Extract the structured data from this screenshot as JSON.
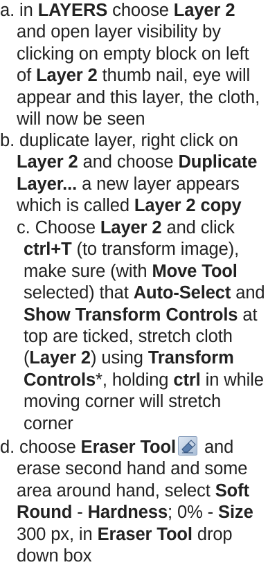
{
  "a": {
    "l1": [
      "a. in ",
      "LAYERS",
      " choose ",
      "Layer 2"
    ],
    "l2": "and open layer visibility by",
    "l3": "clicking on empty block on left",
    "l4": [
      "of ",
      "Layer 2",
      " thumb nail, eye will"
    ],
    "l5": "appear and this layer, the cloth,",
    "l6": "will now be seen"
  },
  "b": {
    "l1": "b. duplicate layer, right click on",
    "l2": [
      "Layer 2",
      " and choose ",
      "Duplicate"
    ],
    "l3": [
      "Layer...",
      " a new layer appears"
    ],
    "l4": [
      "which is called ",
      "Layer 2 copy"
    ]
  },
  "c": {
    "l1": [
      "c. Choose ",
      "Layer 2",
      " and click"
    ],
    "l2": [
      "ctrl+T",
      " (to transform image),"
    ],
    "l3": [
      "make sure (with ",
      "Move Tool"
    ],
    "l4": [
      "selected) that ",
      "Auto-Select",
      " and"
    ],
    "l5": [
      "Show Transform Controls",
      " at"
    ],
    "l6": "top are ticked, stretch cloth",
    "l7": [
      "(",
      "Layer 2",
      ") using ",
      "Transform"
    ],
    "l8": [
      "Controls",
      "*, holding ",
      "ctrl",
      " in while"
    ],
    "l9": "moving corner will stretch",
    "l10": "corner"
  },
  "d": {
    "l1": [
      "d. choose ",
      "Eraser Tool",
      "and"
    ],
    "l2": "erase second hand and some",
    "l3": [
      "area around hand, select ",
      "Soft"
    ],
    "l4": [
      "Round",
      " - ",
      "Hardness",
      "; 0% - ",
      "Size"
    ],
    "l5": [
      "300 px, in ",
      "Eraser Tool",
      " drop"
    ],
    "l6": "down box",
    "eraser_icon": "eraser-tool-icon"
  },
  "colors": {
    "text": "#222222",
    "background": "#ffffff"
  }
}
